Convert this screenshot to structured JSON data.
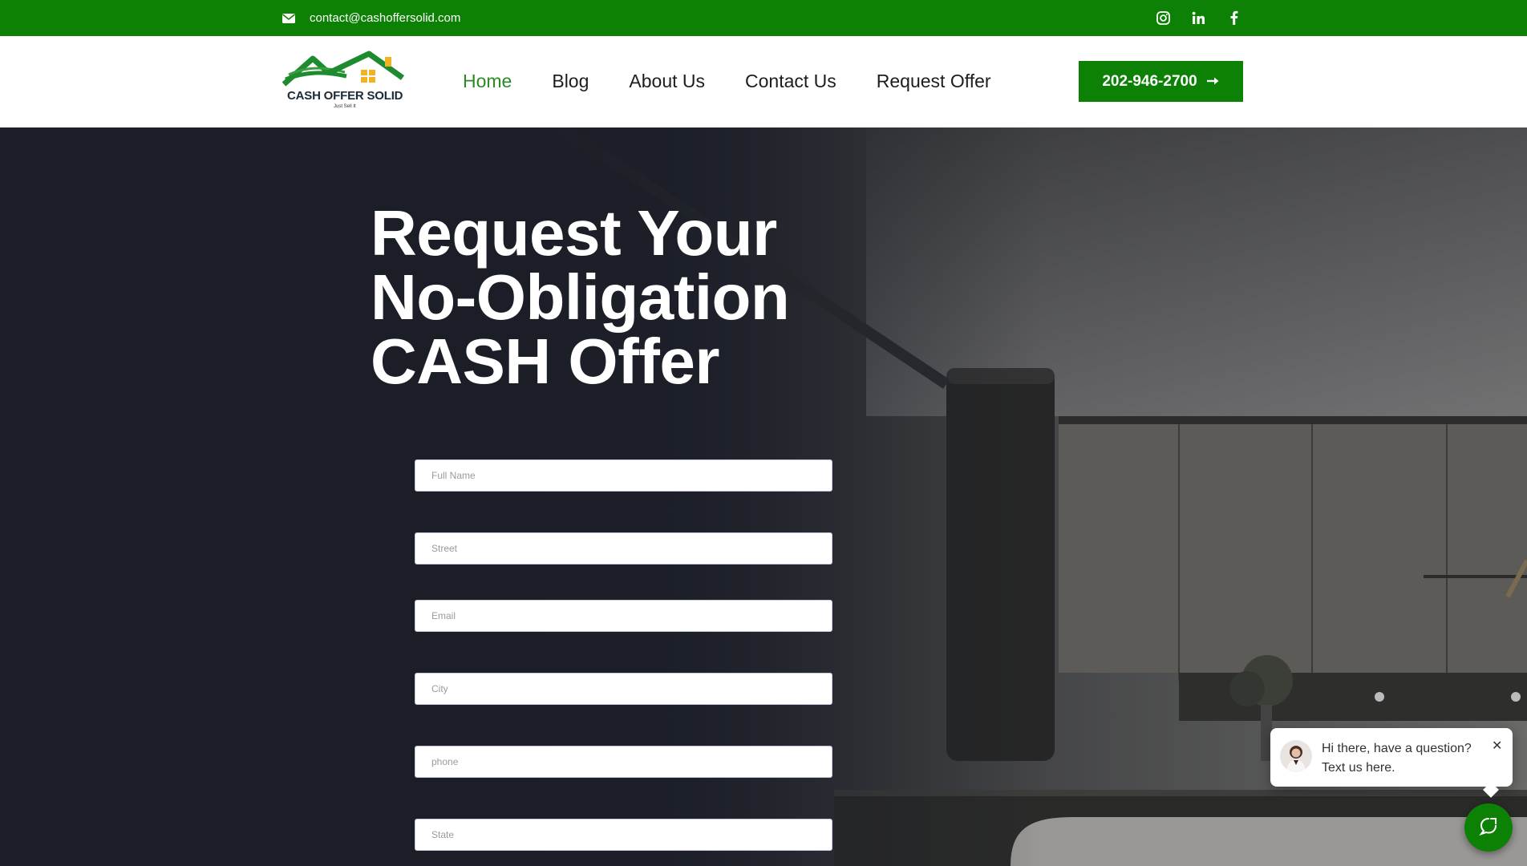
{
  "topbar": {
    "email": "contact@cashoffersolid.com",
    "socials": [
      "instagram-icon",
      "linkedin-icon",
      "facebook-icon"
    ]
  },
  "header": {
    "logo_text": "CASH OFFER SOLID",
    "logo_tagline": "Just Sell It",
    "nav": [
      "Home",
      "Blog",
      "About Us",
      "Contact Us",
      "Request Offer"
    ],
    "active_nav": "Home",
    "phone_button": "202-946-2700"
  },
  "hero": {
    "headline": [
      "Request Your",
      "No-Obligation",
      "CASH Offer"
    ],
    "form": {
      "full_name": "Full Name",
      "street": "Street",
      "email": "Email",
      "city": "City",
      "phone": "phone",
      "state": "State"
    }
  },
  "chat": {
    "line1": "Hi there, have a question?",
    "line2": "Text us here.",
    "close": "✕"
  },
  "colors": {
    "brand_green": "#0d8105",
    "nav_active": "#2b8a25",
    "hero_dark": "#1c1f29"
  }
}
